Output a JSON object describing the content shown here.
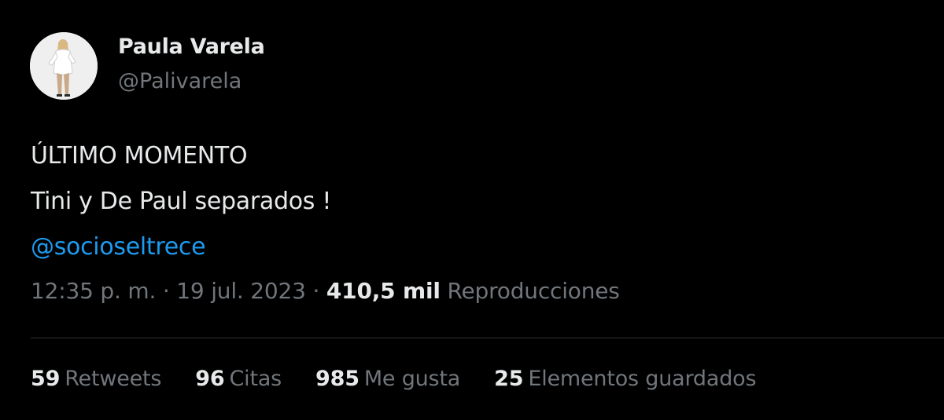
{
  "user": {
    "display_name": "Paula Varela",
    "handle": "@Palivarela",
    "avatar_icon": "user-avatar-photo"
  },
  "tweet": {
    "lines": [
      "ÚLTIMO MOMENTO",
      "Tini y De Paul separados !"
    ],
    "mention": "@socioseltrece"
  },
  "meta": {
    "time": "12:35 p. m.",
    "separator": "·",
    "date": "19 jul. 2023",
    "views_count": "410,5 mil",
    "views_label": "Reproducciones"
  },
  "stats": [
    {
      "count": "59",
      "label": "Retweets"
    },
    {
      "count": "96",
      "label": "Citas"
    },
    {
      "count": "985",
      "label": "Me gusta"
    },
    {
      "count": "25",
      "label": "Elementos guardados"
    }
  ],
  "colors": {
    "background": "#000000",
    "text": "#e7e9ea",
    "secondary": "#71767b",
    "link": "#1d9bf0",
    "divider": "#2f3336"
  }
}
